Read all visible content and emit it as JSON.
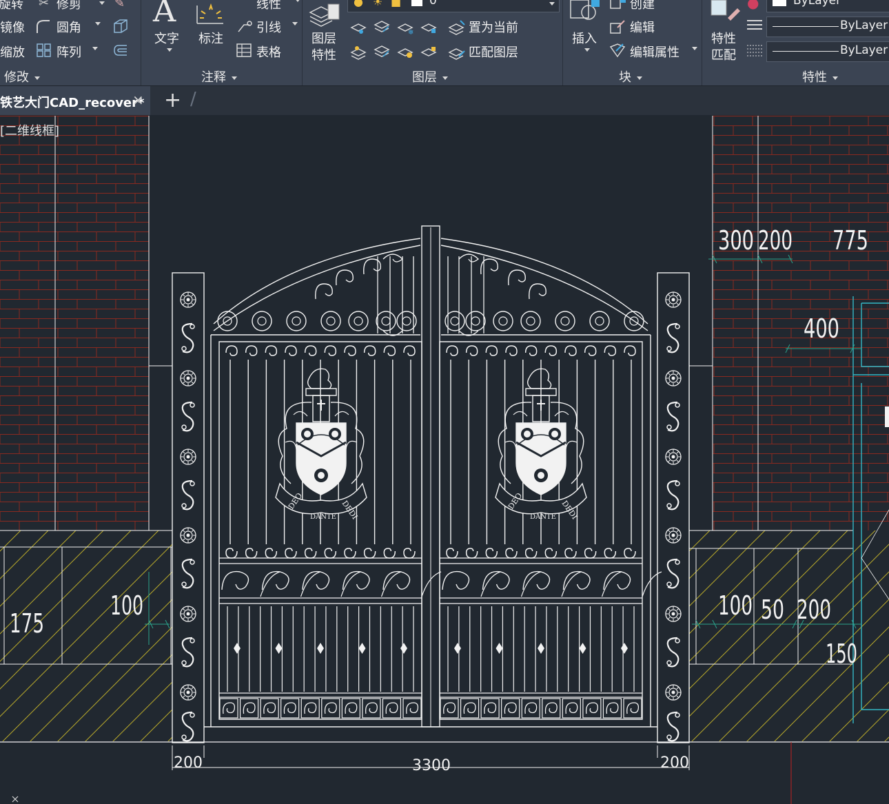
{
  "ribbon": {
    "modify": {
      "rotate": "旋转",
      "trim": "修剪",
      "mirror": "镜像",
      "fillet": "圆角",
      "scale": "缩放",
      "array": "阵列",
      "panel": "修改"
    },
    "annotation": {
      "text": "文字",
      "dimension": "标注",
      "linear": "线性",
      "leader": "引线",
      "table": "表格",
      "panel": "注释"
    },
    "layers": {
      "layer_props": "图层\n特性",
      "layer_props_l1": "图层",
      "layer_props_l2": "特性",
      "current_layer": "0",
      "make_current": "置为当前",
      "match_layer": "匹配图层",
      "panel": "图层"
    },
    "block": {
      "insert": "插入",
      "create": "创建",
      "edit": "编辑",
      "edit_attributes": "编辑属性",
      "panel": "块"
    },
    "properties": {
      "match_l1": "特性",
      "match_l2": "匹配",
      "color": "ByLayer",
      "linetype": "ByLayer",
      "lineweight": "ByLayer",
      "panel": "特性"
    }
  },
  "tabs": {
    "active_title": "铁艺大门CAD_recover*",
    "close": "×",
    "add": "+"
  },
  "viewport": {
    "view_label": "[二维线框]"
  },
  "dimensions": {
    "top_a": "300",
    "top_b": "200",
    "top_c": "775",
    "right_mid": "400",
    "left_a": "175",
    "left_b": "100",
    "right_a": "100",
    "right_b": "50",
    "right_c": "200",
    "right_d": "150",
    "bottom_left": "200",
    "bottom_total": "3300",
    "bottom_right": "200"
  },
  "shield_motto": {
    "left": "DEO",
    "center": "DANTE",
    "right": "DEDI"
  },
  "colors": {
    "canvas_bg": "#212830",
    "brick_line": "#8a2a20",
    "hatch": "#b8a92a",
    "cyan": "#34b7c6",
    "dim_green": "#2aa28a",
    "line_white": "#f2f2f2"
  }
}
